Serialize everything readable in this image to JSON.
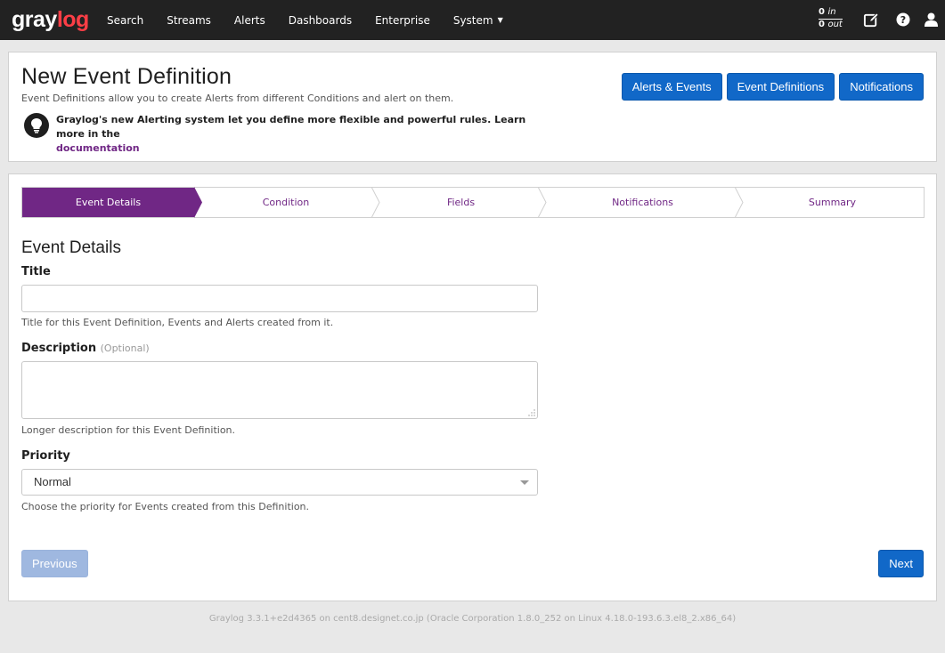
{
  "nav": {
    "logo_part1": "gray",
    "logo_part2": "log",
    "items": [
      "Search",
      "Streams",
      "Alerts",
      "Dashboards",
      "Enterprise",
      "System"
    ],
    "throughput_in_value": "0",
    "throughput_in_unit": "in",
    "throughput_out_value": "0",
    "throughput_out_unit": "out",
    "icons": [
      "edit-icon",
      "help-icon",
      "user-icon"
    ]
  },
  "header": {
    "title": "New Event Definition",
    "subtitle": "Event Definitions allow you to create Alerts from different Conditions and alert on them.",
    "buttons": [
      "Alerts & Events",
      "Event Definitions",
      "Notifications"
    ],
    "info_text": "Graylog's new Alerting system let you define more flexible and powerful rules. Learn more in the",
    "info_link": "documentation"
  },
  "steps": [
    "Event Details",
    "Condition",
    "Fields",
    "Notifications",
    "Summary"
  ],
  "active_step": "Event Details",
  "form": {
    "section_title": "Event Details",
    "title_label": "Title",
    "title_value": "",
    "title_help": "Title for this Event Definition, Events and Alerts created from it.",
    "description_label": "Description",
    "description_optional": "(Optional)",
    "description_value": "",
    "description_help": "Longer description for this Event Definition.",
    "priority_label": "Priority",
    "priority_value": "Normal",
    "priority_help": "Choose the priority for Events created from this Definition."
  },
  "actions": {
    "previous": "Previous",
    "next": "Next"
  },
  "footer": "Graylog 3.3.1+e2d4365 on cent8.designet.co.jp (Oracle Corporation 1.8.0_252 on Linux 4.18.0-193.6.3.el8_2.x86_64)",
  "colors": {
    "navbar": "#222222",
    "primary": "#1168c8",
    "accent": "#702785",
    "logo_red": "#fc3e46"
  }
}
